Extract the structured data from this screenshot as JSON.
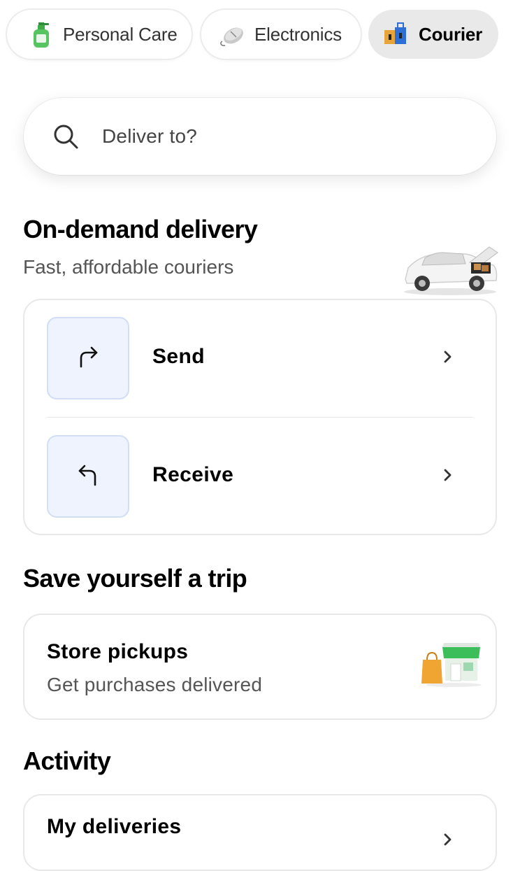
{
  "categories": [
    {
      "label": "Personal Care",
      "icon": "soap-bottle-icon",
      "active": false
    },
    {
      "label": "Electronics",
      "icon": "mouse-icon",
      "active": false
    },
    {
      "label": "Courier",
      "icon": "courier-boxes-icon",
      "active": true
    }
  ],
  "search": {
    "placeholder": "Deliver to?",
    "icon": "search-icon"
  },
  "on_demand": {
    "title": "On-demand delivery",
    "subtitle": "Fast, affordable couriers",
    "image": "car-with-boxes-illustration",
    "actions": [
      {
        "label": "Send",
        "icon": "arrow-turn-right-icon"
      },
      {
        "label": "Receive",
        "icon": "arrow-turn-left-icon"
      }
    ]
  },
  "trip": {
    "title": "Save yourself a trip",
    "card_title": "Store pickups",
    "card_subtitle": "Get purchases delivered",
    "image": "store-with-bag-illustration"
  },
  "activity": {
    "title": "Activity",
    "card_title": "My deliveries"
  },
  "colors": {
    "accent_tile": "#eef3fd",
    "tile_border": "#d2def3",
    "active_chip": "#e9e9e9"
  }
}
